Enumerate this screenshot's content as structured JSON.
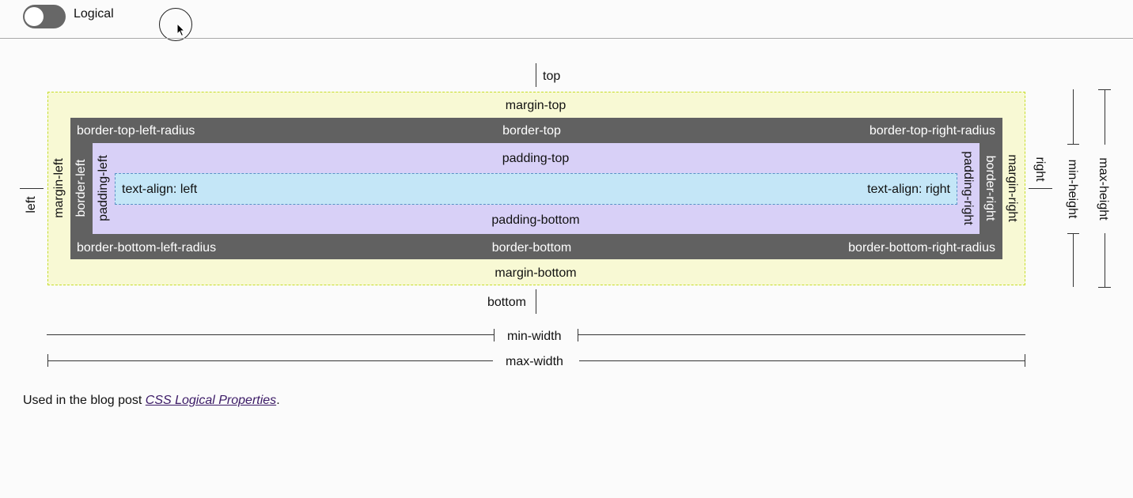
{
  "header": {
    "toggle_label": "Logical",
    "toggle_on": false
  },
  "diagram": {
    "top": "top",
    "bottom": "bottom",
    "left": "left",
    "right": "right",
    "margin_top": "margin-top",
    "margin_bottom": "margin-bottom",
    "margin_left": "margin-left",
    "margin_right": "margin-right",
    "border_top": "border-top",
    "border_bottom": "border-bottom",
    "border_left": "border-left",
    "border_right": "border-right",
    "border_top_left_radius": "border-top-left-radius",
    "border_top_right_radius": "border-top-right-radius",
    "border_bottom_left_radius": "border-bottom-left-radius",
    "border_bottom_right_radius": "border-bottom-right-radius",
    "padding_top": "padding-top",
    "padding_bottom": "padding-bottom",
    "padding_left": "padding-left",
    "padding_right": "padding-right",
    "text_align_left": "text-align: left",
    "text_align_right": "text-align: right",
    "min_width": "min-width",
    "max_width": "max-width",
    "min_height": "min-height",
    "max_height": "max-height"
  },
  "colors": {
    "margin": "#f8f9d4",
    "border": "#616161",
    "padding": "#d8d0f7",
    "content": "#c4e6f7"
  },
  "footer": {
    "prefix": "Used in the blog post ",
    "link_text": "CSS Logical Properties",
    "suffix": "."
  }
}
